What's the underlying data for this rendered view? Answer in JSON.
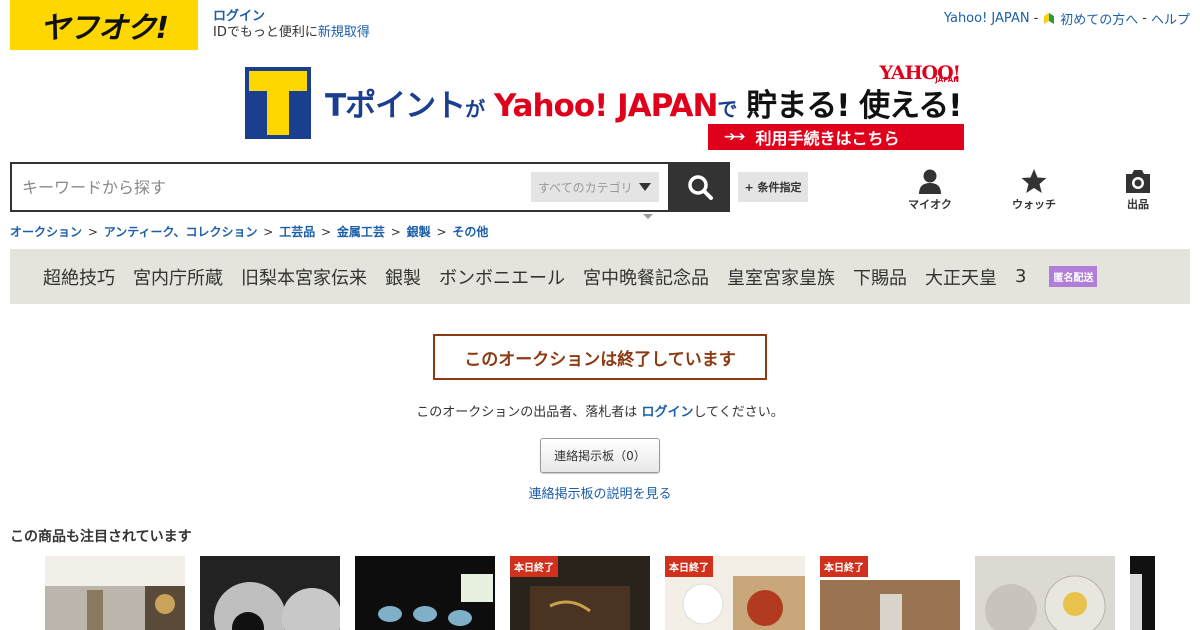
{
  "header": {
    "logo_text": "ヤフオク!",
    "login_label": "ログイン",
    "login_desc": "IDでもっと便利に",
    "register_label": "新規取得",
    "top_links": [
      "Yahoo! JAPAN",
      "初めての方へ",
      "ヘルプ"
    ],
    "top_link_sep": "-"
  },
  "banner": {
    "t_letter": "T",
    "main_blue": "Tポイント",
    "main_small1": "が",
    "main_red": "Yahoo! JAPAN",
    "main_small2": "で",
    "main_black": "貯まる! 使える!",
    "yahoo_logo": "YAHOO!",
    "yahoo_sub": "JAPAN",
    "cta_label": "利用手続きはこちら",
    "cta_arrows": "➔➔"
  },
  "search": {
    "placeholder": "キーワードから探す",
    "category": "すべてのカテゴリ",
    "conditions_label": "+ 条件指定"
  },
  "nav_icons": [
    {
      "label": "マイオク",
      "icon": "person-icon"
    },
    {
      "label": "ウォッチ",
      "icon": "star-icon"
    },
    {
      "label": "出品",
      "icon": "camera-icon"
    }
  ],
  "breadcrumb": {
    "items": [
      "オークション",
      "アンティーク、コレクション",
      "工芸品",
      "金属工芸",
      "銀製",
      "その他"
    ],
    "sep": ">"
  },
  "tags": {
    "items": [
      "超絶技巧",
      "宮内庁所蔵",
      "旧梨本宮家伝来",
      "銀製",
      "ボンボニエール",
      "宮中晩餐記念品",
      "皇室宮家皇族",
      "下賜品",
      "大正天皇",
      "3"
    ],
    "badge": "匿名配送"
  },
  "auction": {
    "ended_title": "このオークションは終了しています",
    "desc_before": "このオークションの出品者、落札者は",
    "desc_link": "ログイン",
    "desc_after": "してください。",
    "board_button": "連絡掲示板（0）",
    "board_help": "連絡掲示板の説明を見る"
  },
  "recommended": {
    "title": "この商品も注目されています",
    "ribbon_label": "本日終了"
  },
  "colors": {
    "brand_yellow": "#ffd700",
    "link_blue": "#1c5fa8",
    "ended_brown": "#8b3a12",
    "ribbon_red": "#d0301c",
    "badge_purple": "#b07ed8"
  }
}
